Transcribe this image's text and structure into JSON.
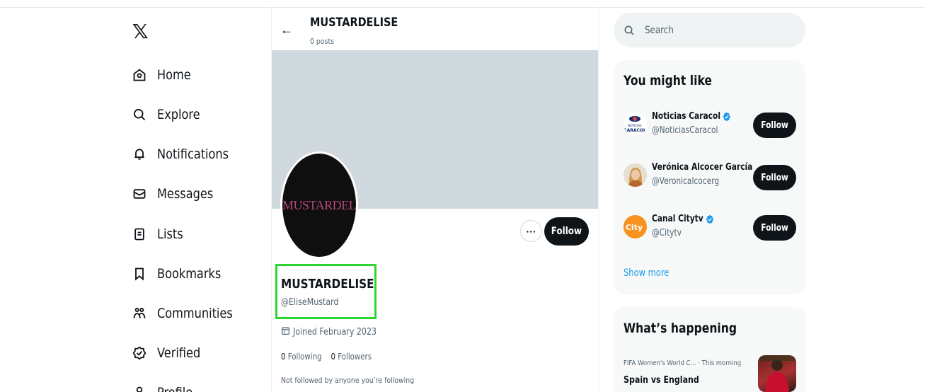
{
  "nav": {
    "logo": "𝕏",
    "items": [
      {
        "label": "Home",
        "icon": "home-icon"
      },
      {
        "label": "Explore",
        "icon": "search-icon"
      },
      {
        "label": "Notifications",
        "icon": "bell-icon"
      },
      {
        "label": "Messages",
        "icon": "envelope-icon"
      },
      {
        "label": "Lists",
        "icon": "list-icon"
      },
      {
        "label": "Bookmarks",
        "icon": "bookmark-icon"
      },
      {
        "label": "Communities",
        "icon": "people-icon"
      },
      {
        "label": "Verified",
        "icon": "verified-icon"
      },
      {
        "label": "Profile",
        "icon": "person-icon"
      }
    ]
  },
  "header": {
    "back_icon": "←",
    "name": "MUSTARDELISE",
    "posts": "0 posts"
  },
  "profile": {
    "avatar_text": "MUSTARDELISE",
    "more_label": "···",
    "follow_label": "Follow",
    "name": "MUSTARDELISE",
    "handle": "@EliseMustard",
    "joined": "Joined February 2023",
    "following_count": "0",
    "following_label": "Following",
    "followers_count": "0",
    "followers_label": "Followers",
    "not_followed": "Not followed by anyone you’re following"
  },
  "search": {
    "placeholder": "Search"
  },
  "suggestions": {
    "title": "You might like",
    "items": [
      {
        "name": "Noticias Caracol",
        "handle": "@NoticiasCaracol",
        "verified": true,
        "follow": "Follow"
      },
      {
        "name": "Verónica Alcocer García",
        "handle": "@Veronicalcocerg",
        "verified": false,
        "follow": "Follow"
      },
      {
        "name": "Canal Citytv",
        "handle": "@Citytv",
        "verified": true,
        "follow": "Follow"
      }
    ],
    "show_more": "Show more"
  },
  "trending": {
    "title": "What’s happening",
    "items": [
      {
        "meta": "FIFA Women's World C... · This morning",
        "title": "Spain vs England"
      }
    ]
  },
  "colors": {
    "accent": "#1d9bf0",
    "highlight": "#2fd62f",
    "dark": "#0f1419",
    "banner": "#cfd9de"
  }
}
